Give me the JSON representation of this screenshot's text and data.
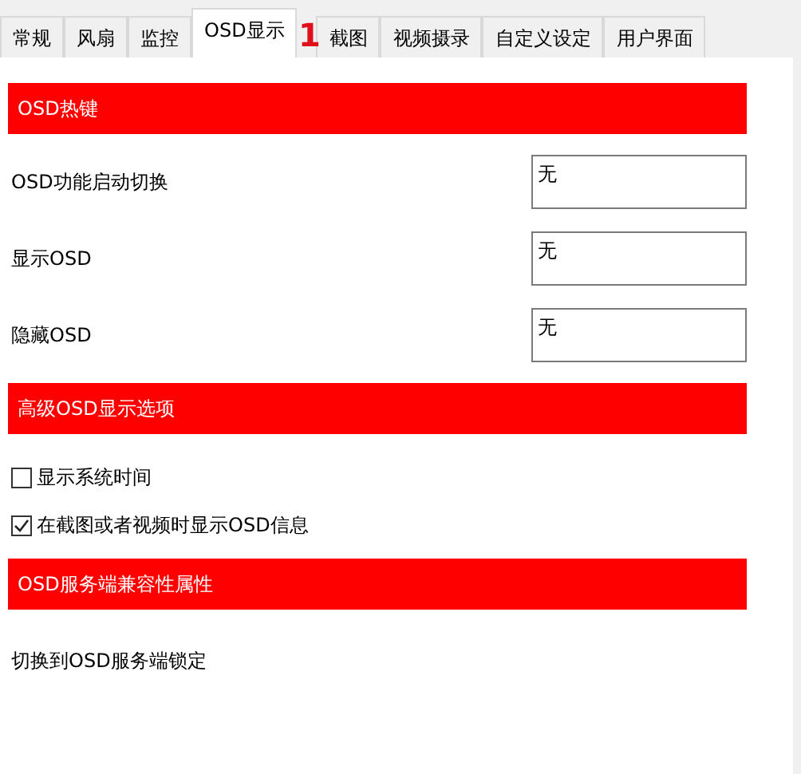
{
  "tabs": [
    {
      "label": "常规",
      "selected": false
    },
    {
      "label": "风扇",
      "selected": false
    },
    {
      "label": "监控",
      "selected": false
    },
    {
      "label": "OSD显示",
      "selected": true
    },
    {
      "label": "截图",
      "selected": false
    },
    {
      "label": "视频摄录",
      "selected": false
    },
    {
      "label": "自定义设定",
      "selected": false
    },
    {
      "label": "用户界面",
      "selected": false
    }
  ],
  "annotation": "1",
  "items": [
    {
      "kind": "header",
      "label": "OSD热键"
    },
    {
      "kind": "hotkey",
      "label": "OSD功能启动切换",
      "value": "无"
    },
    {
      "kind": "hotkey",
      "label": "显示OSD",
      "value": "无"
    },
    {
      "kind": "hotkey",
      "label": "隐藏OSD",
      "value": "无"
    },
    {
      "kind": "header",
      "label": "高级OSD显示选项"
    },
    {
      "kind": "checkbox",
      "label": "显示系统时间",
      "checked": false
    },
    {
      "kind": "checkbox",
      "label": "在截图或者视频时显示OSD信息",
      "checked": true
    },
    {
      "kind": "header",
      "label": "OSD服务端兼容性属性"
    },
    {
      "kind": "text",
      "label": "切换到OSD服务端锁定"
    }
  ]
}
